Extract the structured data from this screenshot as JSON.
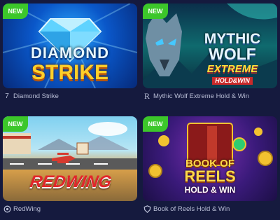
{
  "games": [
    {
      "badge": "NEW",
      "title": "Diamond Strike",
      "logo_line1": "DIAMOND",
      "logo_line2": "STRIKE",
      "provider_icon": "seven-icon"
    },
    {
      "badge": "NEW",
      "title": "Mythic Wolf Extreme Hold & Win",
      "logo_line1": "MYTHIC",
      "logo_line2": "WOLF",
      "logo_line3": "EXTREME",
      "logo_line4": "HOLD&WIN",
      "provider_icon": "r-letter-icon"
    },
    {
      "badge": "NEW",
      "title": "RedWing",
      "logo_line1": "REDWING",
      "provider_icon": "spin-icon"
    },
    {
      "badge": "NEW",
      "title": "Book of Reels Hold & Win",
      "logo_line1": "BOOK OF",
      "logo_line2": "REELS",
      "logo_line3": "HOLD & WIN",
      "provider_icon": "shield-icon"
    }
  ],
  "colors": {
    "background": "#151a3e",
    "badge": "#3cc72a",
    "caption": "#b9bed6"
  }
}
